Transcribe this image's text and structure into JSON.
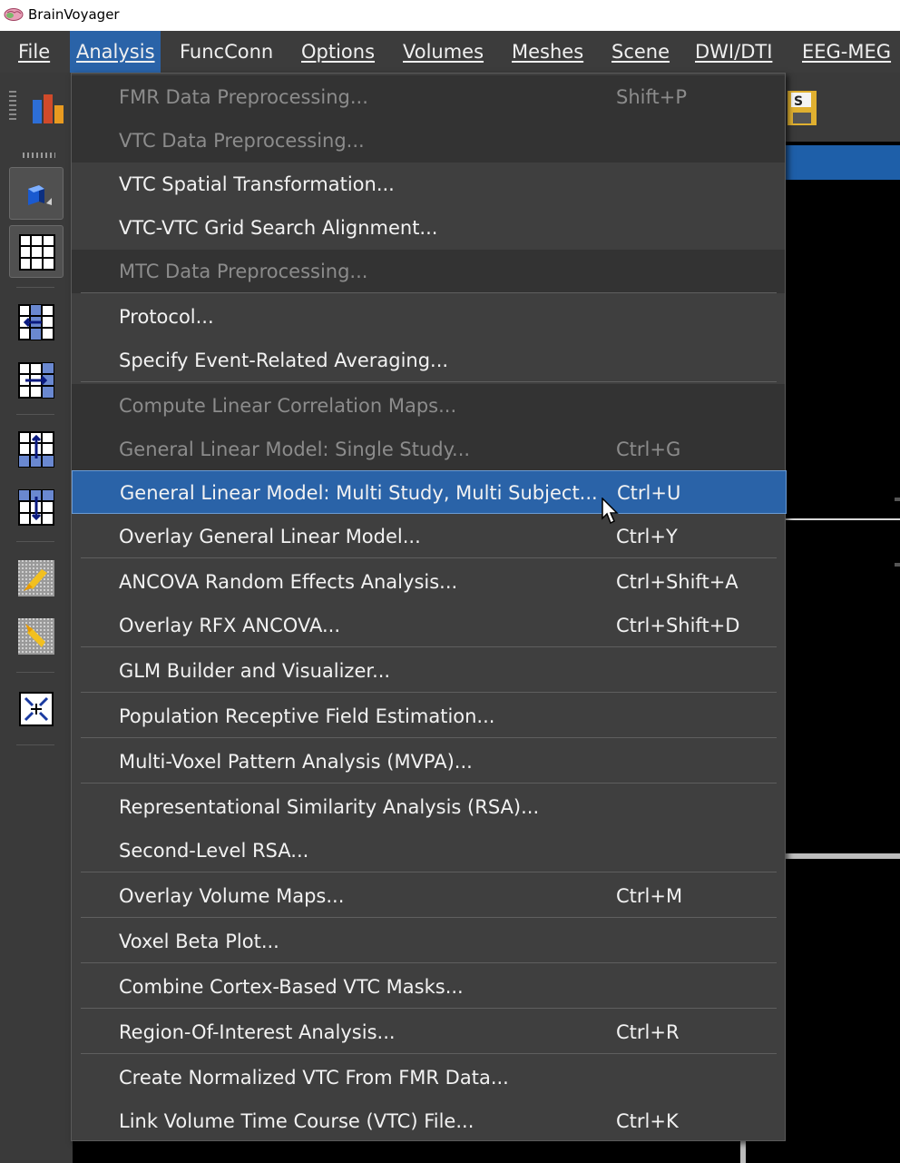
{
  "window": {
    "title": "BrainVoyager"
  },
  "menubar": {
    "items": [
      {
        "label": "File"
      },
      {
        "label": "Analysis"
      },
      {
        "label": "FuncConn"
      },
      {
        "label": "Options"
      },
      {
        "label": "Volumes"
      },
      {
        "label": "Meshes"
      },
      {
        "label": "Scene"
      },
      {
        "label": "DWI/DTI"
      },
      {
        "label": "EEG-MEG"
      }
    ],
    "active": "Analysis"
  },
  "analysis_menu": {
    "items": [
      {
        "label": "FMR Data Preprocessing...",
        "shortcut": "Shift+P",
        "enabled": false
      },
      {
        "label": "VTC Data Preprocessing...",
        "shortcut": "",
        "enabled": false
      },
      {
        "label": "VTC Spatial Transformation...",
        "shortcut": "",
        "enabled": true
      },
      {
        "label": "VTC-VTC Grid Search Alignment...",
        "shortcut": "",
        "enabled": true
      },
      {
        "label": "MTC Data Preprocessing...",
        "shortcut": "",
        "enabled": false
      },
      {
        "label": "Protocol...",
        "shortcut": "",
        "enabled": true
      },
      {
        "label": "Specify Event-Related Averaging...",
        "shortcut": "",
        "enabled": true
      },
      {
        "label": "Compute Linear Correlation Maps...",
        "shortcut": "",
        "enabled": false
      },
      {
        "label": "General Linear Model: Single Study...",
        "shortcut": "Ctrl+G",
        "enabled": false
      },
      {
        "label": "General Linear Model: Multi Study, Multi Subject...",
        "shortcut": "Ctrl+U",
        "enabled": true,
        "highlighted": true
      },
      {
        "label": "Overlay General Linear Model...",
        "shortcut": "Ctrl+Y",
        "enabled": true
      },
      {
        "label": "ANCOVA Random Effects Analysis...",
        "shortcut": "Ctrl+Shift+A",
        "enabled": true
      },
      {
        "label": "Overlay RFX ANCOVA...",
        "shortcut": "Ctrl+Shift+D",
        "enabled": true
      },
      {
        "label": "GLM Builder and Visualizer...",
        "shortcut": "",
        "enabled": true
      },
      {
        "label": "Population Receptive Field Estimation...",
        "shortcut": "",
        "enabled": true
      },
      {
        "label": "Multi-Voxel Pattern Analysis (MVPA)...",
        "shortcut": "",
        "enabled": true
      },
      {
        "label": "Representational Similarity Analysis (RSA)...",
        "shortcut": "",
        "enabled": true
      },
      {
        "label": "Second-Level RSA...",
        "shortcut": "",
        "enabled": true
      },
      {
        "label": "Overlay Volume Maps...",
        "shortcut": "Ctrl+M",
        "enabled": true
      },
      {
        "label": "Voxel Beta Plot...",
        "shortcut": "",
        "enabled": true
      },
      {
        "label": "Combine Cortex-Based VTC Masks...",
        "shortcut": "",
        "enabled": true
      },
      {
        "label": "Region-Of-Interest Analysis...",
        "shortcut": "Ctrl+R",
        "enabled": true
      },
      {
        "label": "Create Normalized VTC From FMR Data...",
        "shortcut": "",
        "enabled": true
      },
      {
        "label": "Link Volume Time Course (VTC) File...",
        "shortcut": "Ctrl+K",
        "enabled": true
      }
    ]
  },
  "colors": {
    "menu_bg": "#3f3f3f",
    "highlight": "#2a63a8",
    "disabled_text": "#8c8c8c",
    "text": "#f2f2f2"
  },
  "icons": {
    "app": "brain-icon",
    "toolbar": [
      "bar-chart-icon",
      "save-icon"
    ],
    "left_tools": [
      "cube-icon",
      "grid-icon",
      "grid-transform-icon",
      "grid-transform-icon",
      "grid-transform-icon",
      "grid-transform-icon",
      "brush-icon",
      "brush-icon",
      "crosshair-icon"
    ]
  }
}
